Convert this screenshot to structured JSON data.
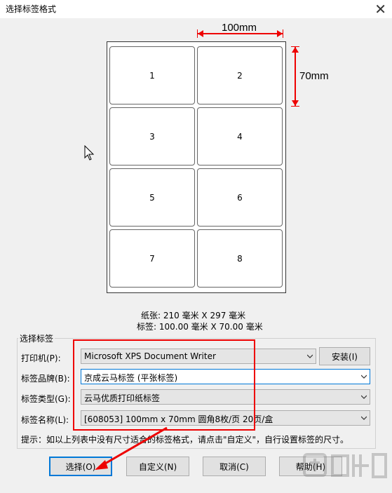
{
  "window": {
    "title": "选择标签格式"
  },
  "preview": {
    "width_dim": "100mm",
    "height_dim": "70mm",
    "labels": [
      "1",
      "2",
      "3",
      "4",
      "5",
      "6",
      "7",
      "8"
    ]
  },
  "info": {
    "paper_label": "纸张:",
    "paper_value": "210 毫米 X 297 毫米",
    "label_label": "标签:",
    "label_value": "100.00 毫米 X 70.00 毫米"
  },
  "group": {
    "legend": "选择标签",
    "printer_label": "打印机(P):",
    "printer_value": "Microsoft XPS Document Writer",
    "install_label": "安装(I)",
    "brand_label": "标签品牌(B):",
    "brand_value": "京成云马标签 (平张标签)",
    "type_label": "标签类型(G):",
    "type_value": "云马优质打印纸标签",
    "name_label": "标签名称(L):",
    "name_value": "[608053] 100mm x 70mm 圆角8枚/页 20页/盒"
  },
  "tip": "提示：如以上列表中没有尺寸适合的标签格式，请点击\"自定义\"，自行设置标签的尺寸。",
  "buttons": {
    "select": "选择(O)",
    "custom": "自定义(N)",
    "cancel": "取消(C)",
    "help": "帮助(H)"
  },
  "colors": {
    "annotation": "#e00000",
    "focus": "#0078d7"
  }
}
